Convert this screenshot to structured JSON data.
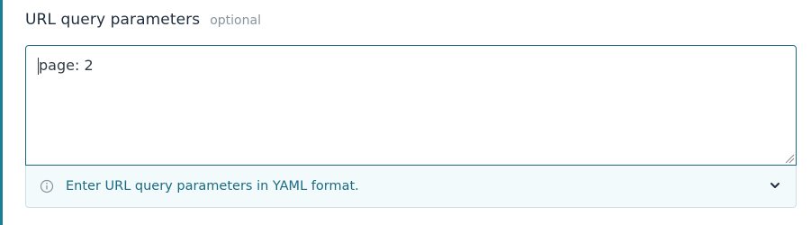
{
  "field": {
    "label": "URL query parameters",
    "optional_label": "optional"
  },
  "textarea": {
    "value": "page: 2"
  },
  "hint": {
    "text": "Enter URL query parameters in YAML format.",
    "info_icon": "info-circle-icon",
    "toggle_icon": "chevron-down-icon"
  },
  "colors": {
    "accent": "#1a7f95",
    "border": "#1a6b82",
    "hint_background": "#f2fafc",
    "hint_text": "#1a6b82"
  }
}
